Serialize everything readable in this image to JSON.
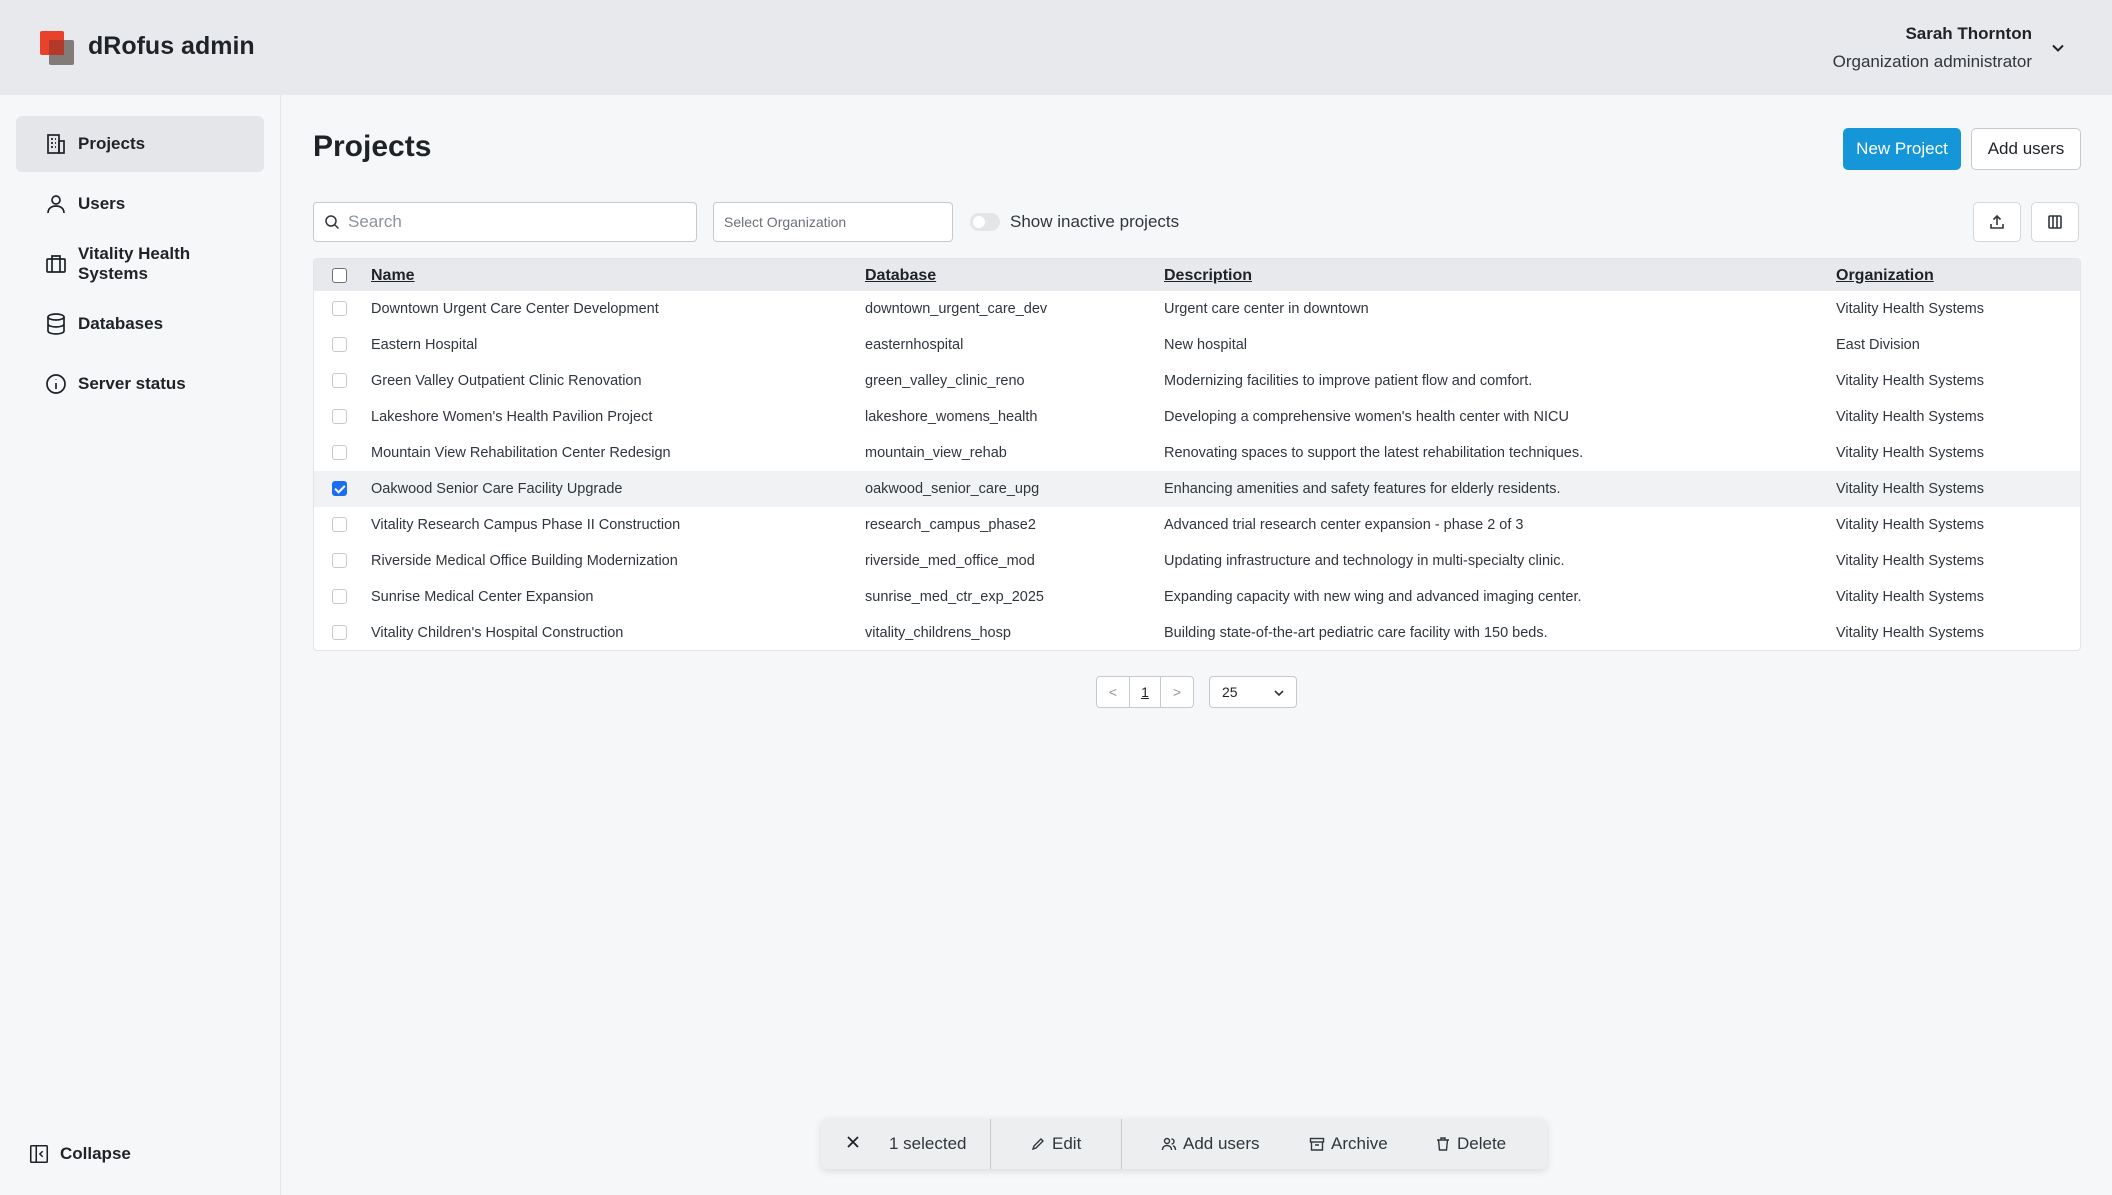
{
  "header": {
    "app_title": "dRofus admin",
    "user_name": "Sarah Thornton",
    "user_role": "Organization administrator"
  },
  "sidebar": {
    "items": [
      {
        "label": "Projects",
        "icon": "building-icon",
        "active": true
      },
      {
        "label": "Users",
        "icon": "user-icon"
      },
      {
        "label": "Vitality Health Systems",
        "icon": "briefcase-icon"
      },
      {
        "label": "Databases",
        "icon": "database-icon"
      },
      {
        "label": "Server status",
        "icon": "info-icon"
      }
    ],
    "collapse_label": "Collapse"
  },
  "main": {
    "title": "Projects",
    "new_project_label": "New Project",
    "add_users_label": "Add users",
    "search_placeholder": "Search",
    "org_select_placeholder": "Select Organization",
    "show_inactive_label": "Show inactive projects"
  },
  "table": {
    "columns": [
      "Name",
      "Database",
      "Description",
      "Organization"
    ],
    "rows": [
      {
        "name": "Downtown Urgent Care Center Development",
        "database": "downtown_urgent_care_dev",
        "description": "Urgent care center in downtown",
        "organization": "Vitality Health Systems",
        "checked": false
      },
      {
        "name": "Eastern Hospital",
        "database": "easternhospital",
        "description": "New hospital",
        "organization": "East Division",
        "checked": false
      },
      {
        "name": "Green Valley Outpatient Clinic Renovation",
        "database": "green_valley_clinic_reno",
        "description": "Modernizing facilities to improve patient flow and comfort.",
        "organization": "Vitality Health Systems",
        "checked": false
      },
      {
        "name": "Lakeshore Women's Health Pavilion Project",
        "database": "lakeshore_womens_health",
        "description": "Developing a comprehensive women's health center with NICU",
        "organization": "Vitality Health Systems",
        "checked": false
      },
      {
        "name": "Mountain View Rehabilitation Center Redesign",
        "database": "mountain_view_rehab",
        "description": "Renovating spaces to support the latest rehabilitation techniques.",
        "organization": "Vitality Health Systems",
        "checked": false
      },
      {
        "name": "Oakwood Senior Care Facility Upgrade",
        "database": "oakwood_senior_care_upg",
        "description": "Enhancing amenities and safety features for elderly residents.",
        "organization": "Vitality Health Systems",
        "checked": true
      },
      {
        "name": "Vitality Research Campus Phase II Construction",
        "database": "research_campus_phase2",
        "description": "Advanced trial research center expansion - phase 2 of 3",
        "organization": "Vitality Health Systems",
        "checked": false
      },
      {
        "name": "Riverside Medical Office Building Modernization",
        "database": "riverside_med_office_mod",
        "description": "Updating infrastructure and technology in multi-specialty clinic.",
        "organization": "Vitality Health Systems",
        "checked": false
      },
      {
        "name": "Sunrise Medical Center Expansion",
        "database": "sunrise_med_ctr_exp_2025",
        "description": "Expanding capacity with new wing and advanced imaging center.",
        "organization": "Vitality Health Systems",
        "checked": false
      },
      {
        "name": "Vitality Children's Hospital Construction",
        "database": "vitality_childrens_hosp",
        "description": "Building state-of-the-art pediatric care facility with 150 beds.",
        "organization": "Vitality Health Systems",
        "checked": false
      }
    ]
  },
  "pagination": {
    "prev": "<",
    "page": "1",
    "next": ">",
    "page_size": "25"
  },
  "action_bar": {
    "selected_label": "1 selected",
    "edit_label": "Edit",
    "add_users_label": "Add users",
    "archive_label": "Archive",
    "delete_label": "Delete"
  },
  "colors": {
    "primary": "#1496d8",
    "checkbox_checked": "#1a6ff0",
    "logo_red": "#e8412c"
  }
}
